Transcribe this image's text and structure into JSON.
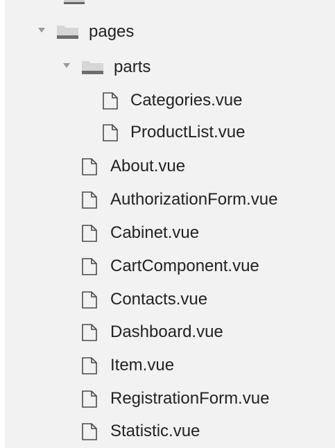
{
  "tree": {
    "folder_pages": "pages",
    "folder_parts": "parts",
    "parts_files": [
      "Categories.vue",
      "ProductList.vue"
    ],
    "pages_files": [
      "About.vue",
      "AuthorizationForm.vue",
      "Cabinet.vue",
      "CartComponent.vue",
      "Contacts.vue",
      "Dashboard.vue",
      "Item.vue",
      "RegistrationForm.vue",
      "Statistic.vue"
    ]
  }
}
